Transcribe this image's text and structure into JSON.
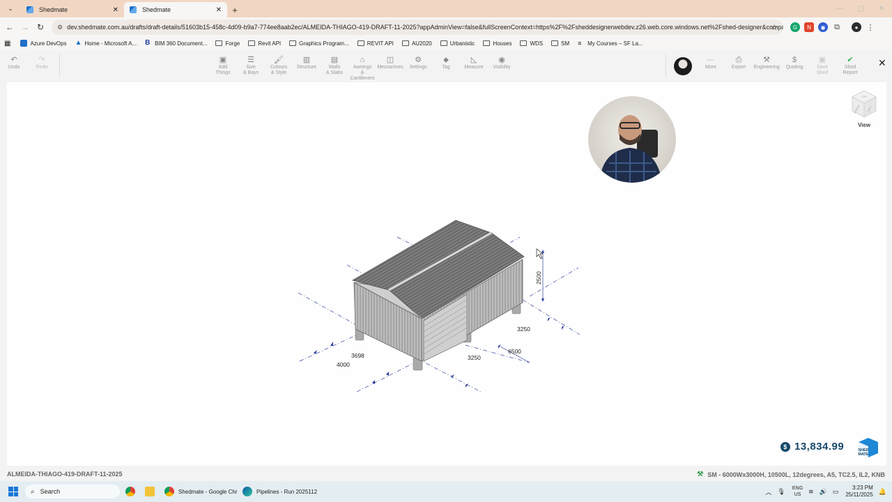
{
  "browser": {
    "tabs": [
      {
        "title": "Shedmate",
        "active": false
      },
      {
        "title": "Shedmate",
        "active": true
      }
    ],
    "url": "dev.shedmate.com.au/drafts/draft-details/51603b15-458c-4d09-b9a7-774ee8aab2ec/ALMEIDA-THIAGO-419-DRAFT-11-2025?appAdminView=false&fullScreenContext=https%2F%2Fsheddesignerwebdev.z26.web.core.windows.net%2Fshed-designer&compa...",
    "bookmarks": [
      {
        "label": "Azure DevOps",
        "icon": "azure-icon"
      },
      {
        "label": "Home - Microsoft A...",
        "icon": "microsoft-icon"
      },
      {
        "label": "BIM 360 Document...",
        "icon": "bim360-icon"
      },
      {
        "label": "Forge",
        "icon": "folder-icon"
      },
      {
        "label": "Revit API",
        "icon": "folder-icon"
      },
      {
        "label": "Graphics Program...",
        "icon": "folder-icon"
      },
      {
        "label": "REVIT API",
        "icon": "folder-icon"
      },
      {
        "label": "AU2020",
        "icon": "folder-icon"
      },
      {
        "label": "Urbanistic",
        "icon": "folder-icon"
      },
      {
        "label": "Houses",
        "icon": "folder-icon"
      },
      {
        "label": "WDS",
        "icon": "folder-icon"
      },
      {
        "label": "SM",
        "icon": "folder-icon"
      },
      {
        "label": "My Courses – SF La...",
        "icon": "course-icon"
      }
    ]
  },
  "toolbar": {
    "undo": "Undo",
    "redo": "Redo",
    "add_things": [
      "Add",
      "Things"
    ],
    "size_bays": [
      "Size",
      "& Bays"
    ],
    "colours_style": [
      "Colours",
      "& Style"
    ],
    "structure": "Structure",
    "walls_slabs": [
      "Walls",
      "& Slabs"
    ],
    "awnings": [
      "Awnings",
      "& Cantilevers"
    ],
    "mezzanines": "Mezzanines",
    "settings": "Settings",
    "tag": "Tag",
    "measure": "Measure",
    "visibility": "Visibility",
    "more": "More",
    "export": "Export",
    "engineering": "Engineering",
    "quoting": "Quoting",
    "save_shed": [
      "Save",
      "Shed"
    ],
    "shed_report": [
      "Shed",
      "Report"
    ]
  },
  "view_label": "View",
  "viewcube_faces": {
    "top": "TOP",
    "front": "FRONT",
    "left": "LEFT"
  },
  "dimensions": {
    "height": "2500",
    "bay_right": "3250",
    "length_total": "6500",
    "bay_front": "3250",
    "width_inner": "3698",
    "width_total": "4000"
  },
  "price": {
    "currency_symbol": "$",
    "amount": "13,834.99"
  },
  "logo_text": [
    "SHED",
    "MATE"
  ],
  "status": {
    "draft_name": "ALMEIDA-THIAGO-419-DRAFT-11-2025",
    "spec": "SM - 6000Wx3000H, 10500L, 12degrees, A5, TC2.5, IL2, KNB"
  },
  "taskbar": {
    "search_placeholder": "Search",
    "apps": [
      {
        "label": "Shedmate - Google Chr"
      },
      {
        "label": "Pipelines - Run 2025112"
      }
    ],
    "lang": [
      "ENG",
      "US"
    ],
    "time": "3:23 PM",
    "date": "25/11/2025"
  }
}
